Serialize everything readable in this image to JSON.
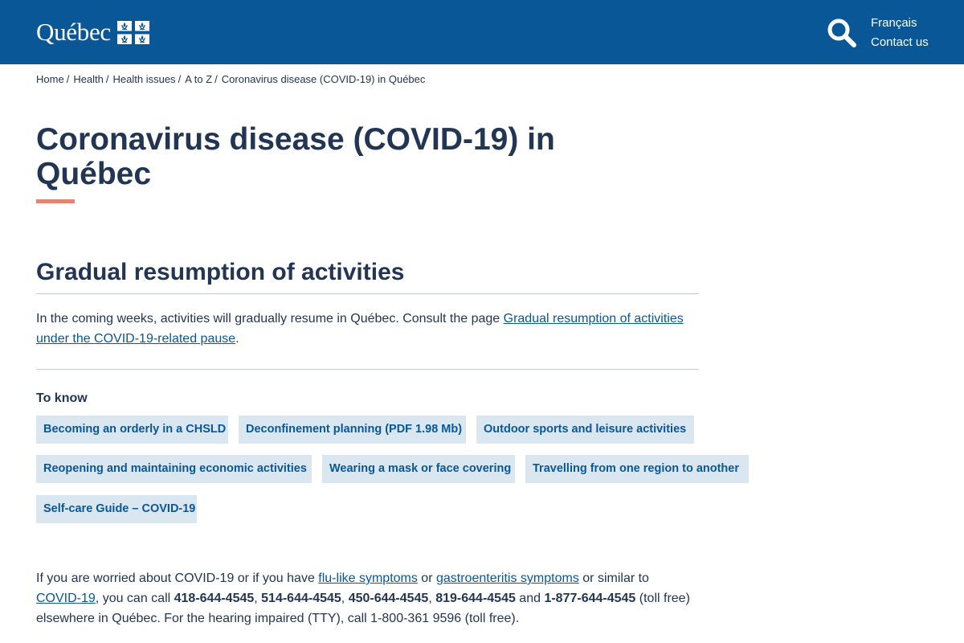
{
  "header": {
    "logo_text": "Québec",
    "search_icon": "search-icon",
    "links": [
      "Français",
      "Contact us"
    ],
    "colors": {
      "bar": "#095797",
      "text": "#ffffff"
    }
  },
  "breadcrumb": {
    "items": [
      "Home",
      "Health",
      "Health issues",
      "A to Z"
    ],
    "separator": "/",
    "current": "Coronavirus disease (COVID-19) in Québec"
  },
  "page": {
    "title": "Coronavirus disease (COVID-19) in Québec",
    "accent_color": "#e58271"
  },
  "section": {
    "title": "Gradual resumption of activities",
    "intro_before": "In the coming weeks, activities will gradually resume in Québec. Consult the page ",
    "intro_link": "Gradual resumption of activities under the COVID-19-related pause",
    "intro_after": "."
  },
  "to_know": {
    "label": "To know",
    "chips": [
      "Becoming an orderly in a CHSLD",
      "Deconfinement planning (PDF 1.98 Mb)",
      "Outdoor sports and leisure activities",
      "Reopening and maintaining economic activities",
      "Wearing a mask or face covering",
      "Travelling from one region to another",
      "Self-care Guide – COVID-19"
    ],
    "chip_bg": "#dae6f0",
    "chip_text": "#095797"
  },
  "contact": {
    "t1": "If you are worried about COVID-19 or if you have ",
    "link1": "flu-like symptoms",
    "t2": " or ",
    "link2": "gastroenteritis symptoms",
    "t3": " or similar to ",
    "link3": "COVID-19",
    "t4": ", you can call ",
    "phone1": "418-644-4545",
    "comma1": ", ",
    "phone2": "514-644-4545",
    "comma2": ", ",
    "phone3": "450-644-4545",
    "comma3": ", ",
    "phone4": "819-644-4545",
    "and": " and ",
    "phone5": "1-877-644-4545",
    "t5": " (toll free) elsewhere in Québec. For the hearing impaired (TTY), call 1-800-361 9596 (toll free)."
  }
}
